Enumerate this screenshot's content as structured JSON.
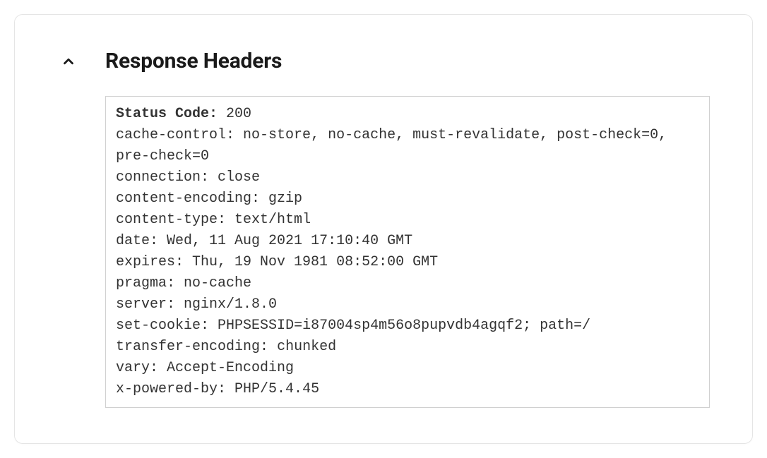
{
  "panel": {
    "title": "Response Headers",
    "expanded": true,
    "status": {
      "label": "Status Code",
      "value": "200"
    },
    "headers": [
      {
        "name": "cache-control",
        "value": "no-store, no-cache, must-revalidate, post-check=0, pre-check=0"
      },
      {
        "name": "connection",
        "value": "close"
      },
      {
        "name": "content-encoding",
        "value": "gzip"
      },
      {
        "name": "content-type",
        "value": "text/html"
      },
      {
        "name": "date",
        "value": "Wed, 11 Aug 2021 17:10:40 GMT"
      },
      {
        "name": "expires",
        "value": "Thu, 19 Nov 1981 08:52:00 GMT"
      },
      {
        "name": "pragma",
        "value": "no-cache"
      },
      {
        "name": "server",
        "value": "nginx/1.8.0"
      },
      {
        "name": "set-cookie",
        "value": "PHPSESSID=i87004sp4m56o8pupvdb4agqf2; path=/"
      },
      {
        "name": "transfer-encoding",
        "value": "chunked"
      },
      {
        "name": "vary",
        "value": "Accept-Encoding"
      },
      {
        "name": "x-powered-by",
        "value": "PHP/5.4.45"
      }
    ]
  }
}
